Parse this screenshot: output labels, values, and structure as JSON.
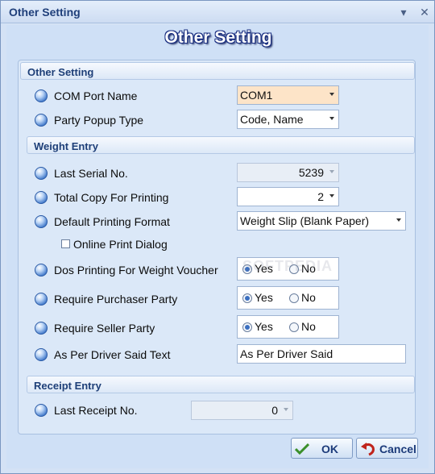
{
  "window": {
    "title": "Other Setting"
  },
  "header": {
    "title": "Other Setting"
  },
  "sections": {
    "other": {
      "title": "Other Setting"
    },
    "weight": {
      "title": "Weight Entry"
    },
    "receipt": {
      "title": "Receipt Entry"
    }
  },
  "fields": {
    "com_port": {
      "label": "COM Port Name",
      "value": "COM1"
    },
    "party_popup": {
      "label": "Party Popup Type",
      "value": "Code, Name"
    },
    "last_serial": {
      "label": "Last Serial No.",
      "value": "5239"
    },
    "total_copy": {
      "label": "Total Copy For Printing",
      "value": "2"
    },
    "print_format": {
      "label": "Default Printing Format",
      "value": "Weight Slip (Blank Paper)"
    },
    "online_print": {
      "label": "Online Print Dialog",
      "checked": false
    },
    "dos_printing": {
      "label": "Dos Printing For Weight Voucher",
      "yes": "Yes",
      "no": "No",
      "selected": "Yes"
    },
    "require_purchaser": {
      "label": "Require Purchaser Party",
      "yes": "Yes",
      "no": "No",
      "selected": "Yes"
    },
    "require_seller": {
      "label": "Require Seller Party",
      "yes": "Yes",
      "no": "No",
      "selected": "Yes"
    },
    "driver_said": {
      "label": "As Per Driver Said Text",
      "value": "As Per Driver Said"
    },
    "last_receipt": {
      "label": "Last Receipt No.",
      "value": "0"
    }
  },
  "buttons": {
    "ok": "OK",
    "cancel": "Cancel"
  },
  "watermark": "SOFTPEDIA"
}
